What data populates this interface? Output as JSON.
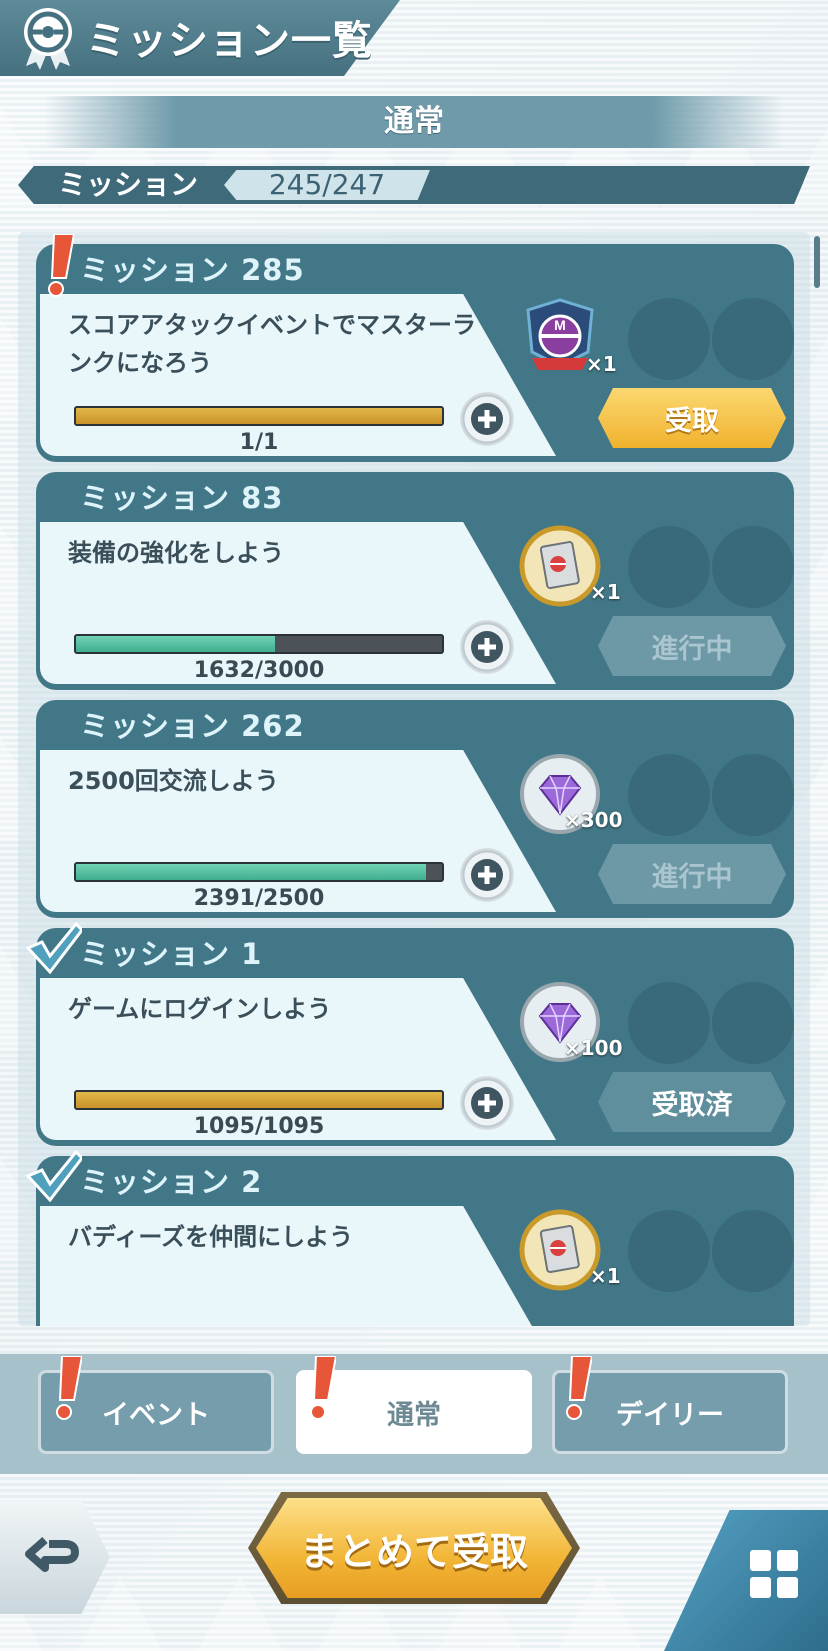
{
  "header": {
    "title": "ミッション一覧"
  },
  "section": {
    "title": "通常"
  },
  "mission_count": {
    "label": "ミッション",
    "value": "245/247"
  },
  "missions": [
    {
      "title": "ミッション 285",
      "desc": "スコアアタックイベントでマスターランクになろう",
      "progress_text": "1/1",
      "progress": 1.0,
      "fill": "gold",
      "reward_qty": "×1",
      "reward_icon": "master-rank-badge-icon",
      "action": "受取",
      "status": "claimable",
      "badge": "new"
    },
    {
      "title": "ミッション 83",
      "desc": "装備の強化をしよう",
      "progress_text": "1632/3000",
      "progress": 0.544,
      "fill": "green",
      "reward_qty": "×1",
      "reward_icon": "ticket-book-icon",
      "action": "進行中",
      "status": "in-progress",
      "badge": ""
    },
    {
      "title": "ミッション 262",
      "desc": "2500回交流しよう",
      "progress_text": "2391/2500",
      "progress": 0.956,
      "fill": "green",
      "reward_qty": "×300",
      "reward_icon": "gem-icon",
      "action": "進行中",
      "status": "in-progress",
      "badge": ""
    },
    {
      "title": "ミッション 1",
      "desc": "ゲームにログインしよう",
      "progress_text": "1095/1095",
      "progress": 1.0,
      "fill": "gold",
      "reward_qty": "×100",
      "reward_icon": "gem-icon",
      "action": "受取済",
      "status": "claimed",
      "badge": "check"
    },
    {
      "title": "ミッション 2",
      "desc": "バディーズを仲間にしよう",
      "progress_text": "",
      "progress": 0,
      "fill": "gold",
      "reward_qty": "×1",
      "reward_icon": "ticket-book-icon",
      "action": "",
      "status": "claimed",
      "badge": "check"
    }
  ],
  "tabs": [
    {
      "label": "イベント",
      "active": false
    },
    {
      "label": "通常",
      "active": true
    },
    {
      "label": "デイリー",
      "active": false
    }
  ],
  "footer": {
    "bulk_claim_label": "まとめて受取"
  },
  "colors": {
    "card": "#427788",
    "claim": "#f0b22e",
    "accent": "#45707f"
  }
}
